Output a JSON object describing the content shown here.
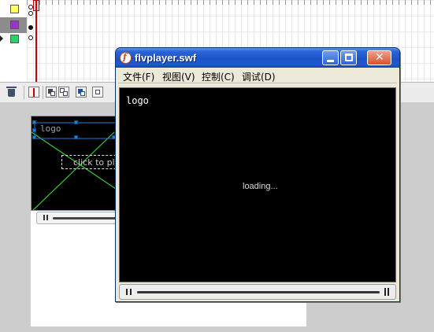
{
  "timeline": {
    "layers": [
      {
        "swatch_color": "#ffff66"
      },
      {
        "swatch_color": "#9933cc"
      },
      {
        "swatch_color": "#33cc66"
      }
    ],
    "icons": [
      "trash-icon",
      "onion-skin-icon",
      "onion-outline-icon",
      "edit-multiple-frames-icon",
      "modify-markers-icon"
    ]
  },
  "stage": {
    "logo_text": "logo",
    "click_to_play_text": "click to play"
  },
  "player": {
    "title": "flvplayer.swf",
    "menu": [
      "文件(F)",
      "视图(V)",
      "控制(C)",
      "调试(D)"
    ],
    "logo_text": "logo",
    "loading_text": "loading...",
    "icons": [
      "flash-app-icon",
      "minimize-icon",
      "maximize-icon",
      "close-icon",
      "pause-icon",
      "volume-icon"
    ]
  },
  "colors": {
    "titlebar": "#1c54c7",
    "stage_outline": "#33cc33",
    "selection_handle": "#1e7fd6",
    "playhead": "#cc0000"
  }
}
